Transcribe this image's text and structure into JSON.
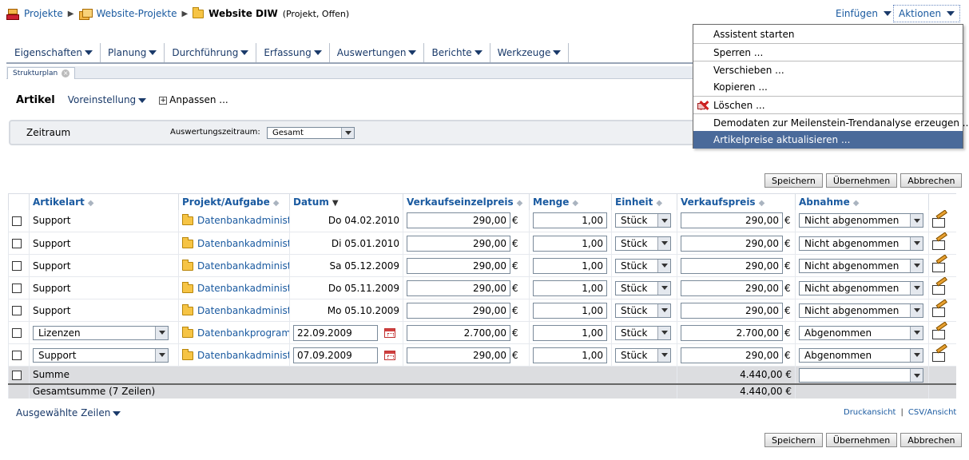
{
  "breadcrumb": {
    "item1": "Projekte",
    "item2": "Website-Projekte",
    "current": "Website DIW",
    "current_meta": "(Projekt, Offen)"
  },
  "top_menu": {
    "einfuegen": "Einfügen",
    "aktionen": "Aktionen"
  },
  "main_toolbar": [
    "Eigenschaften",
    "Planung",
    "Durchführung",
    "Erfassung",
    "Auswertungen",
    "Berichte",
    "Werkzeuge"
  ],
  "tab": {
    "label": "Strukturplan"
  },
  "view": {
    "title": "Artikel",
    "preset": "Voreinstellung",
    "customize": "Anpassen ..."
  },
  "filter": {
    "label": "Zeitraum",
    "period_label": "Auswertungszeitraum:",
    "period_value": "Gesamt"
  },
  "buttons": {
    "save": "Speichern",
    "apply": "Übernehmen",
    "cancel": "Abbrechen"
  },
  "table": {
    "columns": [
      "Artikelart",
      "Projekt/Aufgabe",
      "Datum",
      "Verkaufseinzelpreis",
      "Menge",
      "Einheit",
      "Verkaufspreis",
      "Abnahme"
    ],
    "currency": "€",
    "rows": [
      {
        "artikelart": "Support",
        "projekt": "Datenbankadministi",
        "datum": "Do 04.02.2010",
        "vep": "290,00",
        "menge": "1,00",
        "einheit": "Stück",
        "vp": "290,00",
        "abnahme": "Nicht abgenommen",
        "editable": false
      },
      {
        "artikelart": "Support",
        "projekt": "Datenbankadministi",
        "datum": "Di 05.01.2010",
        "vep": "290,00",
        "menge": "1,00",
        "einheit": "Stück",
        "vp": "290,00",
        "abnahme": "Nicht abgenommen",
        "editable": false
      },
      {
        "artikelart": "Support",
        "projekt": "Datenbankadministi",
        "datum": "Sa 05.12.2009",
        "vep": "290,00",
        "menge": "1,00",
        "einheit": "Stück",
        "vp": "290,00",
        "abnahme": "Nicht abgenommen",
        "editable": false
      },
      {
        "artikelart": "Support",
        "projekt": "Datenbankadministi",
        "datum": "Do 05.11.2009",
        "vep": "290,00",
        "menge": "1,00",
        "einheit": "Stück",
        "vp": "290,00",
        "abnahme": "Nicht abgenommen",
        "editable": false
      },
      {
        "artikelart": "Support",
        "projekt": "Datenbankadministi",
        "datum": "Mo 05.10.2009",
        "vep": "290,00",
        "menge": "1,00",
        "einheit": "Stück",
        "vp": "290,00",
        "abnahme": "Nicht abgenommen",
        "editable": false
      },
      {
        "artikelart": "Lizenzen",
        "projekt": "Datenbankprogram",
        "datum": "22.09.2009",
        "vep": "2.700,00",
        "menge": "1,00",
        "einheit": "Stück",
        "vp": "2.700,00",
        "abnahme": "Abgenommen",
        "editable": true
      },
      {
        "artikelart": "Support",
        "projekt": "Datenbankadministi",
        "datum": "07.09.2009",
        "vep": "290,00",
        "menge": "1,00",
        "einheit": "Stück",
        "vp": "290,00",
        "abnahme": "Abgenommen",
        "editable": true
      }
    ],
    "summe_label": "Summe",
    "summe_value": "4.440,00 €",
    "total_label": "Gesamtsumme (7 Zeilen)",
    "total_value": "4.440,00 €"
  },
  "footer": {
    "selected_rows": "Ausgewählte Zeilen",
    "print": "Druckansicht",
    "csv": "CSV/Ansicht"
  },
  "dropdown": [
    "Assistent starten",
    "Sperren ...",
    "Verschieben ...",
    "Kopieren ...",
    "Löschen ...",
    "Demodaten zur Meilenstein-Trendanalyse erzeugen ...",
    "Artikelpreise aktualisieren ..."
  ]
}
